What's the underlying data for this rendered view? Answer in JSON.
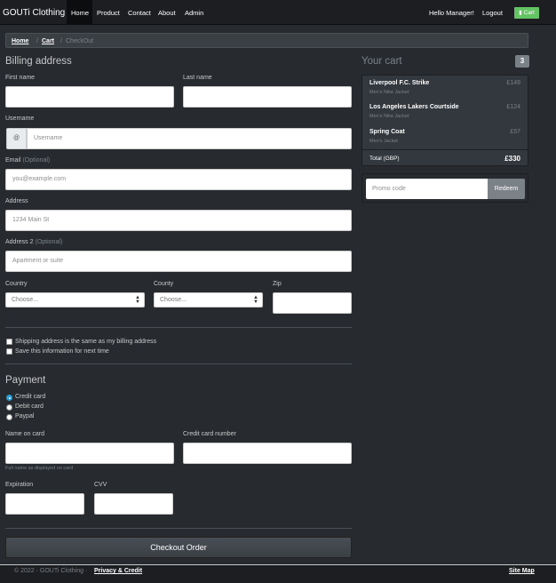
{
  "nav": {
    "brand": "GOUTi Clothing",
    "items": [
      "Home",
      "Product",
      "Contact",
      "About",
      "Admin"
    ],
    "greeting": "Hello Manager!",
    "logout": "Logout",
    "cart": "Cart",
    "cart_icon": "cart-icon"
  },
  "breadcrumb": {
    "home": "Home",
    "cart": "Cart",
    "current": "CheckOut",
    "sep": "/"
  },
  "billing": {
    "title": "Billing address",
    "first_name": "First name",
    "last_name": "Last name",
    "username": "Username",
    "username_addon": "@",
    "username_placeholder": "Username",
    "email": "Email",
    "email_opt": "(Optional)",
    "email_placeholder": "you@example.com",
    "address": "Address",
    "address_placeholder": "1234 Main St",
    "address2": "Address 2",
    "address2_opt": "(Optional)",
    "address2_placeholder": "Apartment or suite",
    "country": "Country",
    "county": "County",
    "zip": "Zip",
    "choose": "Choose...",
    "same_address": "Shipping address is the same as my billing address",
    "save_info": "Save this information for next time"
  },
  "payment": {
    "title": "Payment",
    "methods": [
      "Credit card",
      "Debit card",
      "Paypal"
    ],
    "selected": "Credit card",
    "name_on_card": "Name on card",
    "name_hint": "Full name as displayed on card",
    "card_number": "Credit card number",
    "expiration": "Expiration",
    "cvv": "CVV",
    "checkout": "Checkout Order"
  },
  "cart": {
    "title": "Your cart",
    "count": "3",
    "items": [
      {
        "name": "Liverpool F.C. Strike",
        "desc": "Men's Nike Jacket",
        "price": "£149"
      },
      {
        "name": "Los Angeles Lakers Courtside",
        "desc": "Men's Nike Jacket",
        "price": "£124"
      },
      {
        "name": "Spring Coat",
        "desc": "Men's Jacket",
        "price": "£57"
      }
    ],
    "total_label": "Total (GBP)",
    "total": "£330",
    "promo_placeholder": "Promo code",
    "redeem": "Redeem"
  },
  "footer": {
    "copy": "© 2022 · GOUTi Clothing ·",
    "privacy": "Privacy & Credit",
    "sitemap": "Site Map"
  },
  "colors": {
    "background": "#272b30",
    "navbar": "#1c1e22",
    "cart_button": "#62c462",
    "radio_accent": "#2a9fd6"
  }
}
